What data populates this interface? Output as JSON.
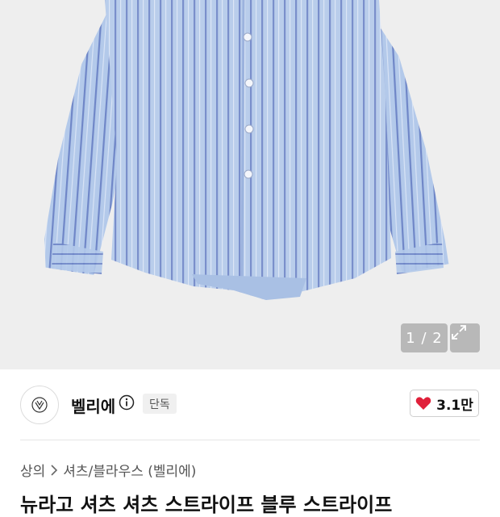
{
  "gallery": {
    "counter": "1 / 2",
    "expand_icon": "expand-arrows-icon"
  },
  "brand": {
    "name": "벨리에",
    "info_icon": "info-icon",
    "badge": "단독",
    "logo_icon": "brand-logo-icon"
  },
  "like": {
    "icon": "heart-icon",
    "color": "#e0203a",
    "count": "3.1만"
  },
  "breadcrumb": {
    "category": "상의",
    "separator_icon": "chevron-right-icon",
    "subcategory": "셔츠/블라우스 (벨리에)"
  },
  "title": "뉴라고 셔츠 셔츠 스트라이프 블루 스트라이프"
}
